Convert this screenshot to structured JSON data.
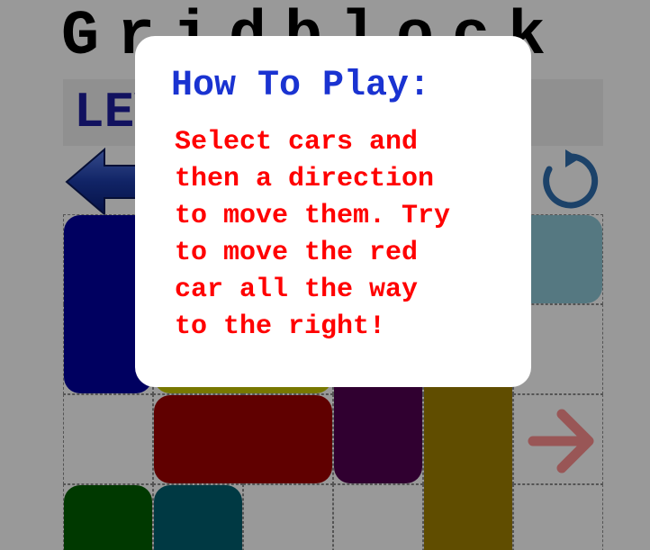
{
  "game": {
    "title": "Gridblock",
    "level_label": "LEVEL 1"
  },
  "controls": {
    "back_icon": "left-arrow-icon",
    "reset_icon": "reset-icon",
    "exit_icon": "right-arrow-icon"
  },
  "board": {
    "columns": 6,
    "rows": 4,
    "cars": [
      {
        "id": "blue-car",
        "color": "#0000a0",
        "col": 0,
        "row": 0,
        "w": 1,
        "h": 2
      },
      {
        "id": "yellow-car",
        "color": "#c8c800",
        "col": 1,
        "row": 1,
        "w": 2,
        "h": 1
      },
      {
        "id": "red-car",
        "color": "#a00000",
        "col": 1,
        "row": 2,
        "w": 2,
        "h": 1
      },
      {
        "id": "purple-car",
        "color": "#500050",
        "col": 3,
        "row": 1,
        "w": 1,
        "h": 2
      },
      {
        "id": "gold-car",
        "color": "#a08000",
        "col": 4,
        "row": 1,
        "w": 1,
        "h": 3
      },
      {
        "id": "lightblue-car",
        "color": "#8ec8d8",
        "col": 5,
        "row": 0,
        "w": 1,
        "h": 1
      },
      {
        "id": "green-car",
        "color": "#006000",
        "col": 0,
        "row": 3,
        "w": 1,
        "h": 1
      },
      {
        "id": "teal-car",
        "color": "#006070",
        "col": 1,
        "row": 3,
        "w": 1,
        "h": 1
      }
    ]
  },
  "dialog": {
    "title": "How To Play:",
    "body": "Select cars and\nthen a direction\nto move them. Try\nto move the red\ncar all the way\nto the right!"
  }
}
